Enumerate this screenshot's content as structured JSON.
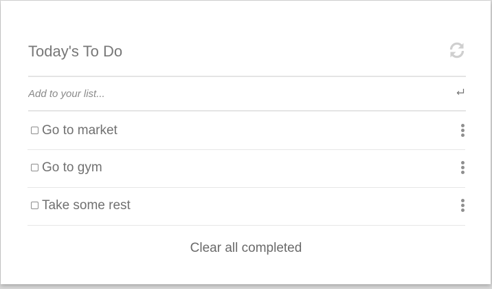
{
  "header": {
    "title": "Today's To Do",
    "refresh_icon": "refresh-icon"
  },
  "add": {
    "placeholder": "Add to your list...",
    "enter_icon": "enter-return-icon"
  },
  "items": [
    {
      "label": "Go to market",
      "checked": false
    },
    {
      "label": "Go to gym",
      "checked": false
    },
    {
      "label": "Take some rest",
      "checked": false
    }
  ],
  "footer": {
    "clear_label": "Clear all completed"
  },
  "colors": {
    "text": "#707070",
    "divider": "#e4e4e4",
    "icon": "#c8c8c8"
  }
}
